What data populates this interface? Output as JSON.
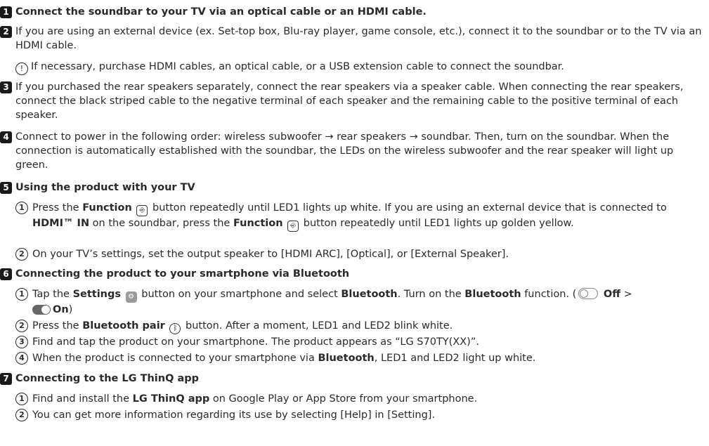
{
  "steps": {
    "s1": {
      "num": "1",
      "text": "Connect the soundbar to your TV via an optical cable or an HDMI cable."
    },
    "s2": {
      "num": "2",
      "text": "If you are using an external device (ex. Set-top box, Blu-ray player, game console, etc.), connect it to the soundbar or to the TV via an HDMI cable."
    },
    "note": {
      "icon": "!",
      "text": "If necessary, purchase HDMI cables, an optical cable, or a USB extension cable to connect the soundbar."
    },
    "s3": {
      "num": "3",
      "text": "If you purchased the rear speakers separately, connect the rear speakers via a speaker cable. When connecting the rear speakers, connect the black striped cable to the negative terminal of each speaker and the remaining cable to the positive terminal of each speaker."
    },
    "s4": {
      "num": "4",
      "text": "Connect to power in the following order: wireless subwoofer → rear speakers → soundbar. Then, turn on the soundbar. When the connection is automatically established with the soundbar, the LEDs on the wireless subwoofer and the rear speaker will light up green."
    },
    "s5": {
      "num": "5",
      "title": "Using the product with your TV",
      "a": {
        "num": "1",
        "p1": "Press the ",
        "b1": "Function",
        "p2": " button repeatedly until LED1 lights up white. If you are using an external device that is connected to ",
        "b2": "HDMI™ IN",
        "p3": " on the soundbar, press the ",
        "b3": "Function",
        "p4": " button repeatedly until LED1 lights up golden yellow."
      },
      "b": {
        "num": "2",
        "text": "On your TV’s settings, set the output speaker to [HDMI ARC], [Optical], or [External Speaker]."
      }
    },
    "s6": {
      "num": "6",
      "title": "Connecting the product to your smartphone via Bluetooth",
      "a": {
        "num": "1",
        "p1": "Tap the ",
        "b1": "Settings",
        "p2": " button on your smartphone and select ",
        "b2": "Bluetooth",
        "p3": ". Turn on the ",
        "b3": "Bluetooth",
        "p4": " function. (",
        "off": "Off",
        "sep": " > ",
        "on": "On",
        "p5": ")"
      },
      "b": {
        "num": "2",
        "p1": "Press the ",
        "b1": "Bluetooth pair",
        "p2": " button. After a moment, LED1 and LED2 blink white."
      },
      "c": {
        "num": "3",
        "text": "Find and tap the product on your smartphone. The product appears as “LG S70TY(XX)”."
      },
      "d": {
        "num": "4",
        "p1": "When the product is connected to your smartphone via ",
        "b1": "Bluetooth",
        "p2": ", LED1 and LED2 light up white."
      }
    },
    "s7": {
      "num": "7",
      "title": "Connecting to the LG ThinQ app",
      "a": {
        "num": "1",
        "p1": "Find and install the ",
        "b1": "LG ThinQ app",
        "p2": " on Google Play or App Store from your smartphone."
      },
      "b": {
        "num": "2",
        "text": "You can get more information regarding its use by selecting [Help] in [Setting]."
      }
    }
  },
  "icons": {
    "function": "input-source-icon",
    "settings": "gear-icon",
    "bluetooth": "bluetooth-icon",
    "warning": "exclamation-circle-icon"
  }
}
